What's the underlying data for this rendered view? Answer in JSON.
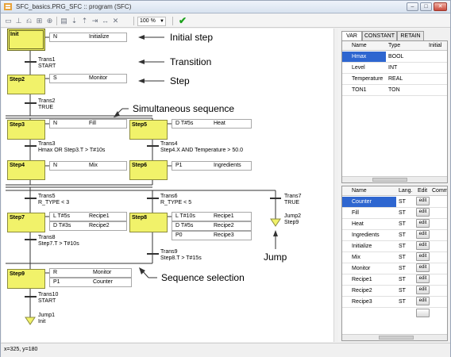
{
  "window": {
    "title": "SFC_basics.PRG_SFC :: program (SFC)",
    "min_label": "–",
    "max_label": "□",
    "close_label": "✕"
  },
  "toolbar": {
    "zoom": "100 %",
    "zoom_arrow": "▼",
    "check_label": "✔",
    "icons": [
      "step-icon",
      "transition-icon",
      "branch-icon",
      "parallel-icon",
      "jump-icon",
      "action-icon",
      "insert-icon",
      "move-up-icon",
      "move-down-icon",
      "properties-icon",
      "delete-icon"
    ]
  },
  "sfc": {
    "steps": {
      "init": "Init",
      "step2": "Step2",
      "step3": "Step3",
      "step4": "Step4",
      "step5": "Step5",
      "step6": "Step6",
      "step7": "Step7",
      "step8": "Step8",
      "step9": "Step9"
    },
    "actions": {
      "init_q": "N",
      "init_v": "Initialize",
      "step2_q": "S",
      "step2_v": "Monitor",
      "step3_q": "N",
      "step3_v": "Fill",
      "step4_q": "N",
      "step4_v": "Mix",
      "step5_q": "D T#5s",
      "step5_v": "Heat",
      "step6_q": "P1",
      "step6_v": "Ingredients",
      "step7a_q": "L T#5s",
      "step7a_v": "Recipe1",
      "step7b_q": "D T#3s",
      "step7b_v": "Recipe2",
      "step8a_q": "L T#10s",
      "step8a_v": "Recipe1",
      "step8b_q": "D T#5s",
      "step8b_v": "Recipe2",
      "step8c_q": "P0",
      "step8c_v": "Recipe3",
      "step9a_q": "R",
      "step9a_v": "Monitor",
      "step9b_q": "P1",
      "step9b_v": "Counter"
    },
    "transitions": {
      "t1_name": "Trans1",
      "t1_cond": "START",
      "t2_name": "Trans2",
      "t2_cond": "TRUE",
      "t3_name": "Trans3",
      "t3_cond": "Hmax OR Step3.T > T#10s",
      "t4_name": "Trans4",
      "t4_cond": "Step4.X AND Temperature > 50.0",
      "t5_name": "Trans5",
      "t5_cond": "R_TYPE < 3",
      "t6_name": "Trans6",
      "t6_cond": "R_TYPE < 5",
      "t7_name": "Trans7",
      "t7_cond": "TRUE",
      "t8_name": "Trans8",
      "t8_cond": "Step7.T > T#10s",
      "t9_name": "Trans9",
      "t9_cond": "Step8.T > T#15s",
      "t10_name": "Trans10",
      "t10_cond": "START"
    },
    "jumps": {
      "jump2_name": "Jump2",
      "jump2_target": "Step9",
      "jump1_name": "Jump1",
      "jump1_target": "Init"
    },
    "annotations": {
      "initial_step": "Initial step",
      "transition": "Transition",
      "step": "Step",
      "simultaneous": "Simultaneous sequence",
      "jump": "Jump",
      "selection": "Sequence selection"
    }
  },
  "status": "x=325, y=180",
  "var_panel": {
    "tabs": [
      "VAR",
      "CONSTANT",
      "RETAIN"
    ],
    "headers": [
      "Name",
      "Type",
      "Initial"
    ],
    "rows": [
      {
        "name": "Hmax",
        "type": "BOOL"
      },
      {
        "name": "Level",
        "type": "INT"
      },
      {
        "name": "Temperature",
        "type": "REAL"
      },
      {
        "name": "TON1",
        "type": "TON"
      }
    ]
  },
  "action_panel": {
    "headers": [
      "Name",
      "Lang.",
      "Edit",
      "Comme"
    ],
    "edit_label": "edit",
    "rows": [
      {
        "name": "Counter",
        "lang": "ST"
      },
      {
        "name": "Fill",
        "lang": "ST"
      },
      {
        "name": "Heat",
        "lang": "ST"
      },
      {
        "name": "Ingredients",
        "lang": "ST"
      },
      {
        "name": "Initialize",
        "lang": "ST"
      },
      {
        "name": "Mix",
        "lang": "ST"
      },
      {
        "name": "Monitor",
        "lang": "ST"
      },
      {
        "name": "Recipe1",
        "lang": "ST"
      },
      {
        "name": "Recipe2",
        "lang": "ST"
      },
      {
        "name": "Recipe3",
        "lang": "ST"
      }
    ]
  }
}
